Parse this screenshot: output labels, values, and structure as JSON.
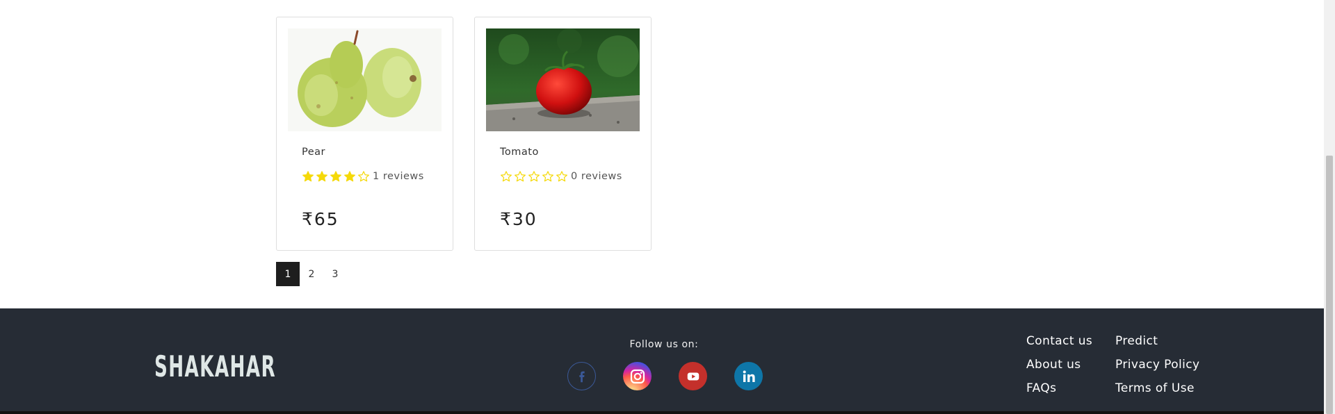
{
  "products": [
    {
      "name": "Pear",
      "rating": 4,
      "max_rating": 5,
      "reviews": "1 reviews",
      "price": "₹65",
      "image": "pear-photo"
    },
    {
      "name": "Tomato",
      "rating": 0,
      "max_rating": 5,
      "reviews": "0 reviews",
      "price": "₹30",
      "image": "tomato-photo"
    }
  ],
  "pagination": {
    "pages": [
      "1",
      "2",
      "3"
    ],
    "active": "1"
  },
  "footer": {
    "logo": "SHAKAHAR",
    "follow_label": "Follow us on:",
    "socials": [
      "facebook-icon",
      "instagram-icon",
      "youtube-icon",
      "linkedin-icon"
    ],
    "links_col1": [
      "Contact us",
      "About us",
      "FAQs"
    ],
    "links_col2": [
      "Predict",
      "Privacy Policy",
      "Terms of Use"
    ]
  },
  "colors": {
    "star": "#f5d90a",
    "footer_bg": "#262c35",
    "active_page": "#1e1e1e"
  }
}
